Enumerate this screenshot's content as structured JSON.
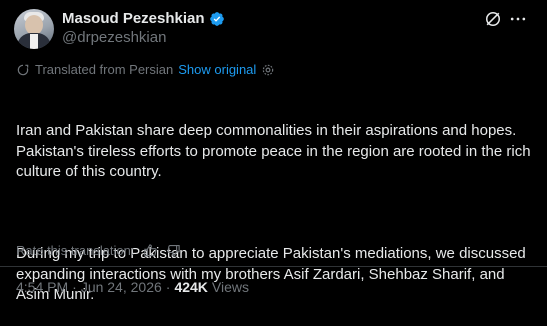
{
  "author": {
    "display_name": "Masoud Pezeshkian",
    "handle": "@drpezeshkian"
  },
  "icons": {
    "verified": "verified-badge-icon",
    "grok": "grok-icon",
    "more": "more-icon",
    "translate": "translate-icon",
    "settings": "settings-gear-icon",
    "thumbs_up": "thumbs-up-icon",
    "thumbs_down": "thumbs-down-icon"
  },
  "translation": {
    "label": "Translated from Persian",
    "show_original": "Show original"
  },
  "tweet": {
    "paragraph1": "Iran and Pakistan share deep commonalities in their aspirations and hopes. Pakistan's tireless efforts to promote peace in the region are rooted in the rich culture of this country.",
    "paragraph2": "During my trip to Pakistan to appreciate Pakistan's mediations, we discussed expanding interactions with my brothers Asif Zardari, Shehbaz Sharif, and Asim Munir."
  },
  "rating": {
    "label": "Rate this translation:"
  },
  "meta": {
    "time": "4:54 PM",
    "separator": "·",
    "date": "Jun 24, 2026",
    "views_count": "424K",
    "views_label": "Views"
  },
  "colors": {
    "background": "#000000",
    "text": "#e7e9ea",
    "secondary": "#71767b",
    "link": "#1d9bf0",
    "verified": "#1d9bf0",
    "divider": "#2f3336"
  }
}
